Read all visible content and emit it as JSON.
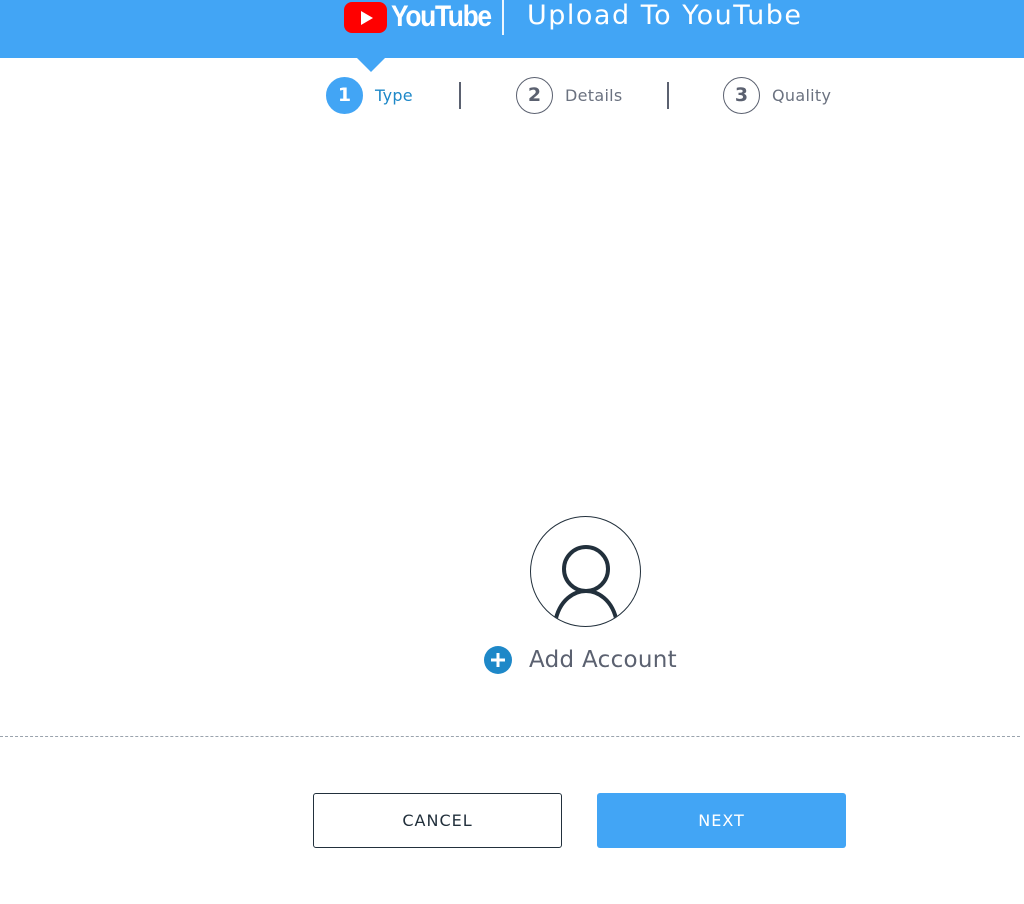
{
  "header": {
    "logo_text": "YouTube",
    "title": "Upload To YouTube"
  },
  "steps": [
    {
      "number": "1",
      "label": "Type",
      "active": true
    },
    {
      "number": "2",
      "label": "Details",
      "active": false
    },
    {
      "number": "3",
      "label": "Quality",
      "active": false
    }
  ],
  "account": {
    "add_label": "Add Account"
  },
  "footer": {
    "cancel_label": "CANCEL",
    "next_label": "NEXT"
  },
  "colors": {
    "accent": "#42a5f5",
    "youtube_red": "#ff0000",
    "active_step_text": "#1e88c8"
  }
}
